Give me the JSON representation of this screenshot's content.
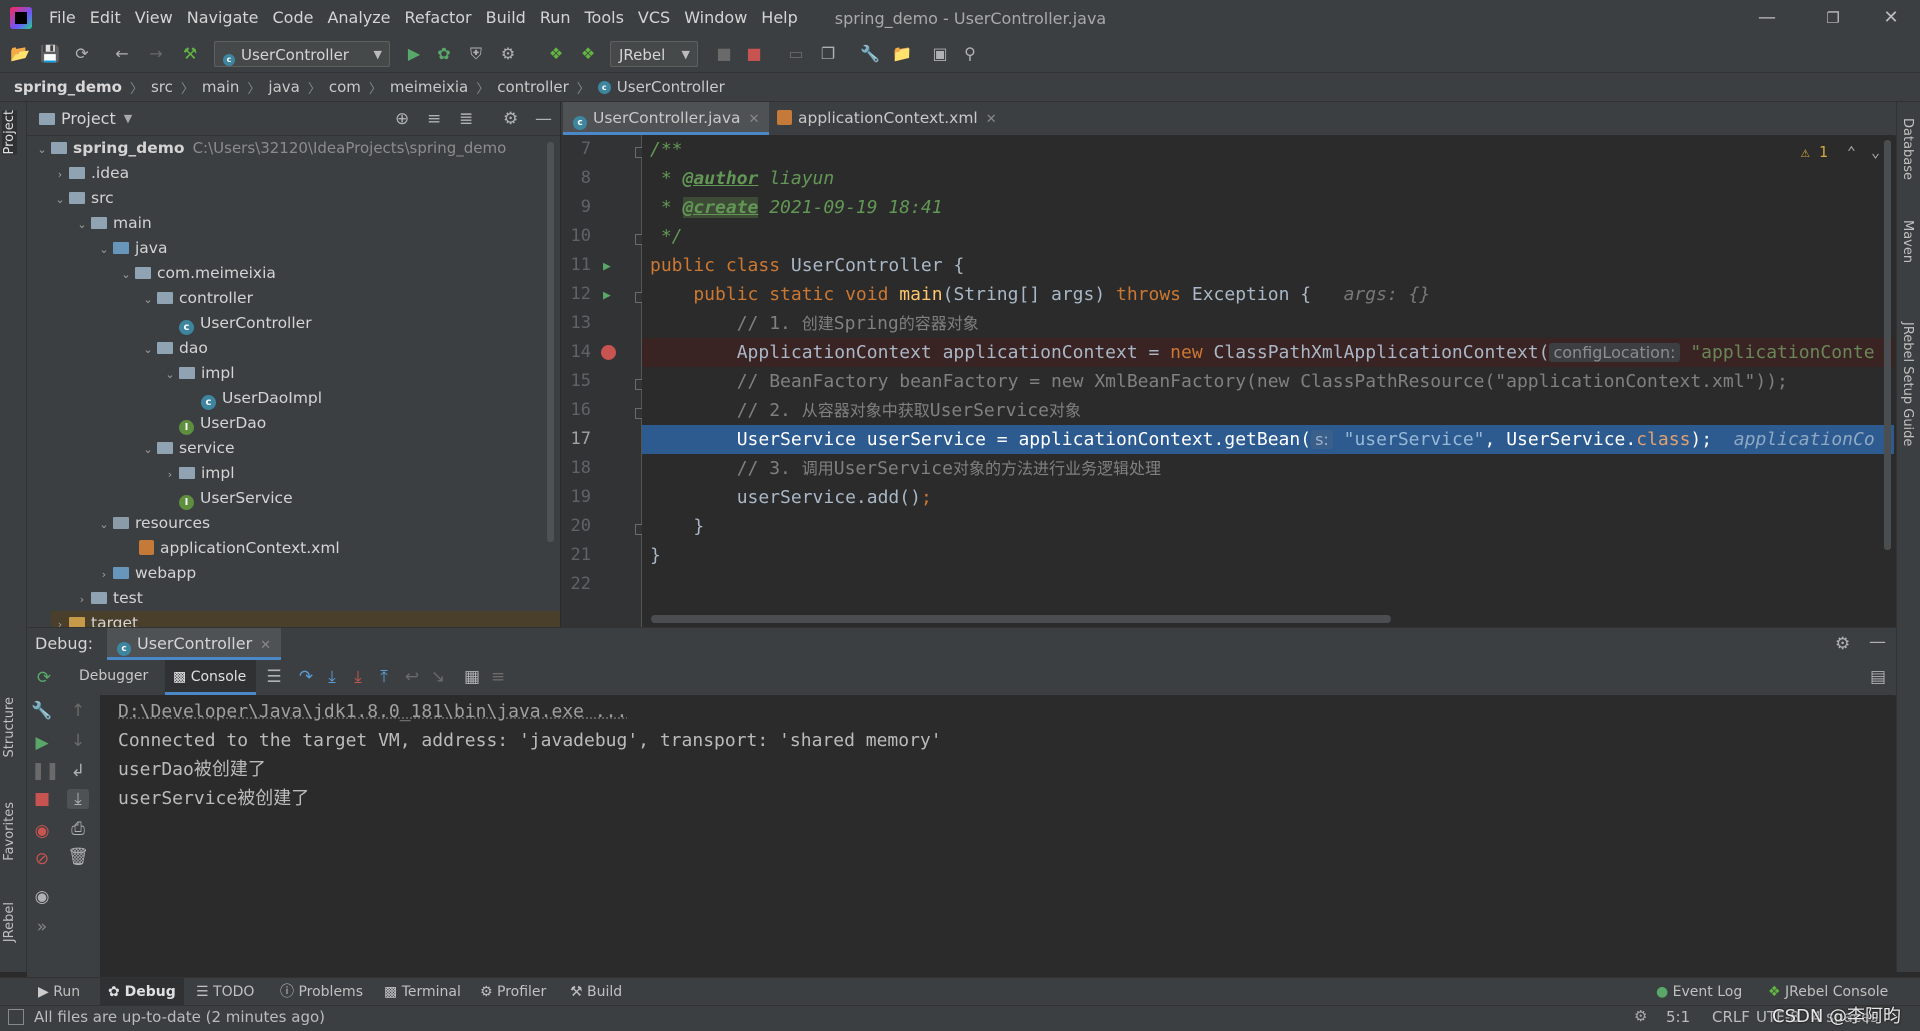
{
  "menu": [
    "File",
    "Edit",
    "View",
    "Navigate",
    "Code",
    "Analyze",
    "Refactor",
    "Build",
    "Run",
    "Tools",
    "VCS",
    "Window",
    "Help"
  ],
  "window_title": "spring_demo - UserController.java",
  "toolbar": {
    "run_config": "UserController",
    "jrebel": "JRebel"
  },
  "breadcrumb": [
    "spring_demo",
    "src",
    "main",
    "java",
    "com",
    "meimeixia",
    "controller",
    "UserController"
  ],
  "project": {
    "title": "Project",
    "tree": [
      {
        "label": "spring_demo",
        "path": "C:\\Users\\32120\\IdeaProjects\\spring_demo"
      },
      {
        "label": ".idea"
      },
      {
        "label": "src"
      },
      {
        "label": "main"
      },
      {
        "label": "java"
      },
      {
        "label": "com.meimeixia"
      },
      {
        "label": "controller"
      },
      {
        "label": "UserController"
      },
      {
        "label": "dao"
      },
      {
        "label": "impl"
      },
      {
        "label": "UserDaoImpl"
      },
      {
        "label": "UserDao"
      },
      {
        "label": "service"
      },
      {
        "label": "impl"
      },
      {
        "label": "UserService"
      },
      {
        "label": "resources"
      },
      {
        "label": "applicationContext.xml"
      },
      {
        "label": "webapp"
      },
      {
        "label": "test"
      },
      {
        "label": "target"
      }
    ]
  },
  "editor": {
    "tabs": [
      "UserController.java",
      "applicationContext.xml"
    ],
    "warning_count": "1",
    "line_numbers": [
      "7",
      "8",
      "9",
      "10",
      "11",
      "12",
      "13",
      "14",
      "15",
      "16",
      "17",
      "18",
      "19",
      "20",
      "21",
      "22"
    ],
    "code": {
      "l7": "/**",
      "l8_star": " * ",
      "l8_tag": "@author",
      "l8_text": " liayun",
      "l9_star": " * ",
      "l9_tag": "@create",
      "l9_text": " 2021-09-19 18:41",
      "l10": " */",
      "l11_kw": "public class",
      "l11_rest": " UserController {",
      "l12_kw": "    public static void",
      "l12_fn": " main",
      "l12_mid": "(String[] args) ",
      "l12_throws": "throws",
      "l12_rest": " Exception {",
      "l12_hint": "args: {}",
      "l13_cm": "        // 1. ",
      "l13_cjk1": "创建",
      "l13_cm2": "Spring",
      "l13_cjk2": "的容器对象",
      "l14_a": "        ApplicationContext applicationContext = ",
      "l14_new": "new",
      "l14_b": " ClassPathXmlApplicationContext(",
      "l14_hint": "configLocation:",
      "l14_str": " \"applicationConte",
      "l15": "        // BeanFactory beanFactory = new XmlBeanFactory(new ClassPathResource(\"applicationContext.xml\"));",
      "l16_cm": "        // 2. ",
      "l16_cjk1": "从容器对象中获取",
      "l16_cm2": "UserService",
      "l16_cjk2": "对象",
      "l17_a": "        UserService userService = applicationContext.getBean(",
      "l17_hint": "s:",
      "l17_str": " \"userService\"",
      "l17_b": ", UserService.",
      "l17_cls": "class",
      "l17_c": ");",
      "l17_tail": "  applicationCo",
      "l18_cm": "        // 3. ",
      "l18_cjk1": "调用",
      "l18_cm2": "UserService",
      "l18_cjk2": "对象的方法进行业务逻辑处理",
      "l19_a": "        userService.add()",
      "l19_b": ";",
      "l20": "    }",
      "l21": "}",
      "l22": ""
    }
  },
  "debug": {
    "label": "Debug:",
    "session": "UserController",
    "tabs": [
      "Debugger",
      "Console"
    ],
    "console": [
      "D:\\Developer\\Java\\jdk1.8.0_181\\bin\\java.exe ...",
      "Connected to the target VM, address: 'javadebug', transport: 'shared memory'",
      "userDao被创建了",
      "userService被创建了"
    ]
  },
  "left_stripe": [
    "Project",
    "Structure",
    "Favorites",
    "JRebel"
  ],
  "right_stripe": [
    "Database",
    "Maven",
    "JRebel Setup Guide"
  ],
  "tool_tabs": [
    "Run",
    "Debug",
    "TODO",
    "Problems",
    "Terminal",
    "Profiler",
    "Build"
  ],
  "tool_tabs_right": [
    "Event Log",
    "JRebel Console"
  ],
  "status": {
    "message": "All files are up-to-date (2 minutes ago)",
    "position": "5:1",
    "line_sep": "CRLF",
    "encoding": "UTF-8",
    "indent": "4 spaces",
    "watermark": "CSDN @李阿昀"
  }
}
